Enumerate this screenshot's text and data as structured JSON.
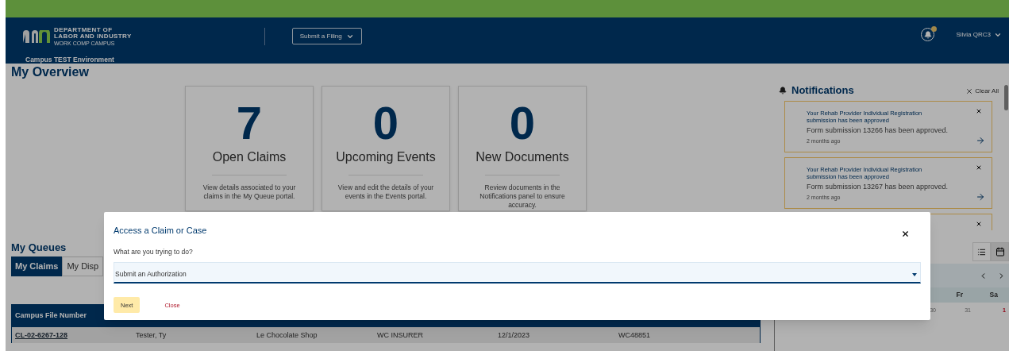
{
  "header": {
    "logo": {
      "line1": "DEPARTMENT OF",
      "line2": "LABOR AND INDUSTRY",
      "line3": "WORK COMP CAMPUS"
    },
    "environment": "Campus TEST Environment",
    "submit_menu": "Submit a Filing",
    "has_unread": true,
    "user": "Silvia QRC3"
  },
  "overview": {
    "title": "My Overview",
    "cards": [
      {
        "count": "7",
        "title": "Open Claims",
        "description": "View details associated to your claims in the My Queue portal."
      },
      {
        "count": "0",
        "title": "Upcoming Events",
        "description": "View and edit the details of your events in the Events portal."
      },
      {
        "count": "0",
        "title": "New Documents",
        "description": "Review documents in the Notifications panel to ensure accuracy."
      }
    ]
  },
  "notifications": {
    "title": "Notifications",
    "clear_all": "Clear All",
    "more_below": true,
    "items": [
      {
        "title": "Your Rehab Provider Individual Registration submission has been approved",
        "body": "Form submission 13266 has been approved.",
        "time": "2 months ago"
      },
      {
        "title": "Your Rehab Provider Individual Registration submission has been approved",
        "body": "Form submission 13267 has been approved.",
        "time": "2 months ago"
      }
    ]
  },
  "queues": {
    "title": "My Queues",
    "tabs": [
      {
        "label": "My Claims",
        "selected": true
      },
      {
        "label": "My Disp",
        "selected": false
      }
    ],
    "table": {
      "columns": [
        "Campus File Number"
      ],
      "rows": [
        {
          "cells": [
            "CL-02-6267-128",
            "Tester, Ty",
            "Le Chocolate Shop",
            "WC INSURER",
            "12/1/2023",
            "WC48851"
          ]
        }
      ]
    }
  },
  "calendar": {
    "views": [
      {
        "kind": "list",
        "selected": false
      },
      {
        "kind": "calendar",
        "selected": true
      }
    ],
    "weekdays": [
      "Fr",
      "Sa"
    ],
    "dates": [
      {
        "day": "30",
        "kind": "other_month"
      },
      {
        "day": "31",
        "kind": "other_month"
      },
      {
        "day": "1",
        "kind": "weekend"
      }
    ]
  },
  "modal": {
    "title": "Access a Claim or Case",
    "prompt": "What are you trying to do?",
    "select": {
      "value": "Submit an Authorization"
    },
    "buttons": [
      {
        "label": "Next",
        "kind": "primary"
      },
      {
        "label": "Close",
        "kind": "link"
      }
    ]
  }
}
